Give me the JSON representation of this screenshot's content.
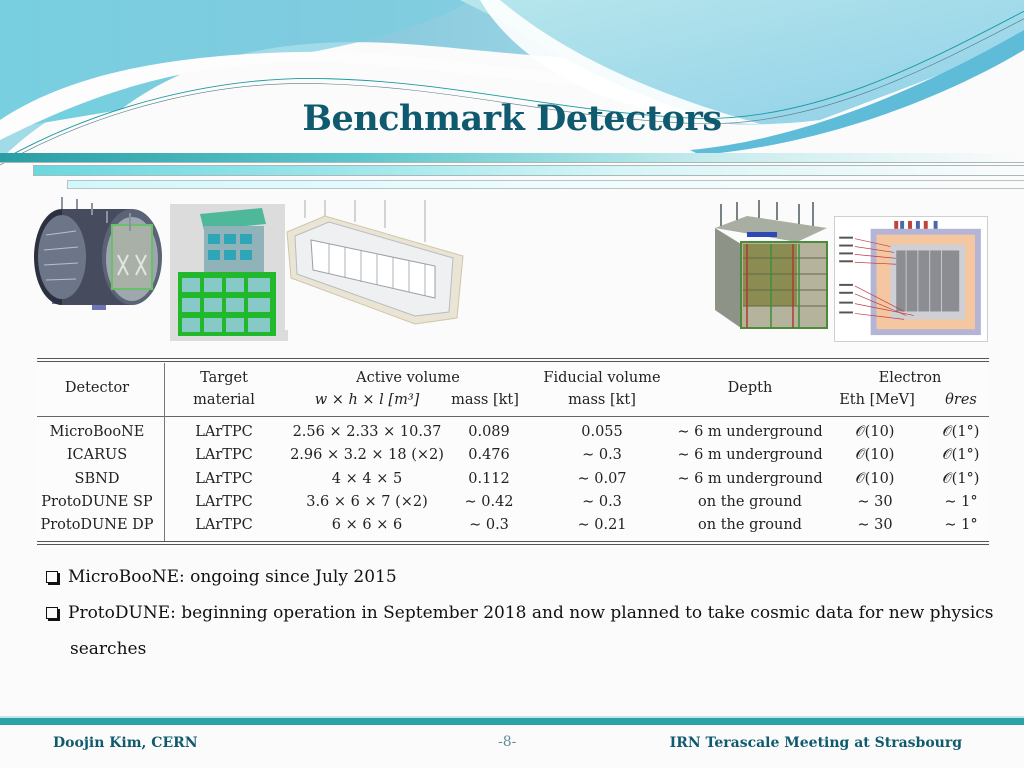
{
  "slide": {
    "title": "Benchmark Detectors"
  },
  "images": [
    {
      "name": "MicroBooNE detector rendering"
    },
    {
      "name": "SBND detector rendering"
    },
    {
      "name": "ICARUS detector rendering"
    },
    {
      "name": "ProtoDUNE SP detector rendering"
    },
    {
      "name": "ProtoDUNE DP detector rendering"
    }
  ],
  "table": {
    "headers": {
      "detector": "Detector",
      "target_1": "Target",
      "target_2": "material",
      "active_volume": "Active volume",
      "active_dims": "w × h × l [m³]",
      "active_mass": "mass [kt]",
      "fiducial_1": "Fiducial volume",
      "fiducial_2": "mass [kt]",
      "depth": "Depth",
      "electron": "Electron",
      "e_th": "Eth [MeV]",
      "theta_res": "θres"
    },
    "rows": [
      {
        "detector": "MicroBooNE",
        "target": "LArTPC",
        "dims": "2.56 × 2.33 × 10.37",
        "mass": "0.089",
        "fiducial": "0.055",
        "depth": "∼ 6 m underground",
        "eth": "𝒪(10)",
        "theta": "𝒪(1°)"
      },
      {
        "detector": "ICARUS",
        "target": "LArTPC",
        "dims": "2.96 × 3.2 × 18 (×2)",
        "mass": "0.476",
        "fiducial": "∼ 0.3",
        "depth": "∼ 6 m underground",
        "eth": "𝒪(10)",
        "theta": "𝒪(1°)"
      },
      {
        "detector": "SBND",
        "target": "LArTPC",
        "dims": "4 × 4 × 5",
        "mass": "0.112",
        "fiducial": "∼ 0.07",
        "depth": "∼ 6 m underground",
        "eth": "𝒪(10)",
        "theta": "𝒪(1°)"
      },
      {
        "detector": "ProtoDUNE SP",
        "target": "LArTPC",
        "dims": "3.6 × 6 × 7 (×2)",
        "mass": "∼ 0.42",
        "fiducial": "∼ 0.3",
        "depth": "on the ground",
        "eth": "∼ 30",
        "theta": "∼ 1°"
      },
      {
        "detector": "ProtoDUNE DP",
        "target": "LArTPC",
        "dims": "6 × 6 × 6",
        "mass": "∼ 0.3",
        "fiducial": "∼ 0.21",
        "depth": "on the ground",
        "eth": "∼ 30",
        "theta": "∼ 1°"
      }
    ]
  },
  "bullets": [
    {
      "text": "MicroBooNE: ongoing since July 2015"
    },
    {
      "text": "ProtoDUNE: beginning operation in September 2018 and now planned to take cosmic data for new physics",
      "continuation": "searches"
    }
  ],
  "footer": {
    "author": "Doojin Kim, CERN",
    "page": "-8-",
    "event": "IRN Terascale Meeting at Strasbourg"
  },
  "colors": {
    "title": "#0f5a6e",
    "accent_bar": "#2ba3a6",
    "wave_light": "#a9dfe6",
    "wave_mid": "#5fc2d3"
  }
}
